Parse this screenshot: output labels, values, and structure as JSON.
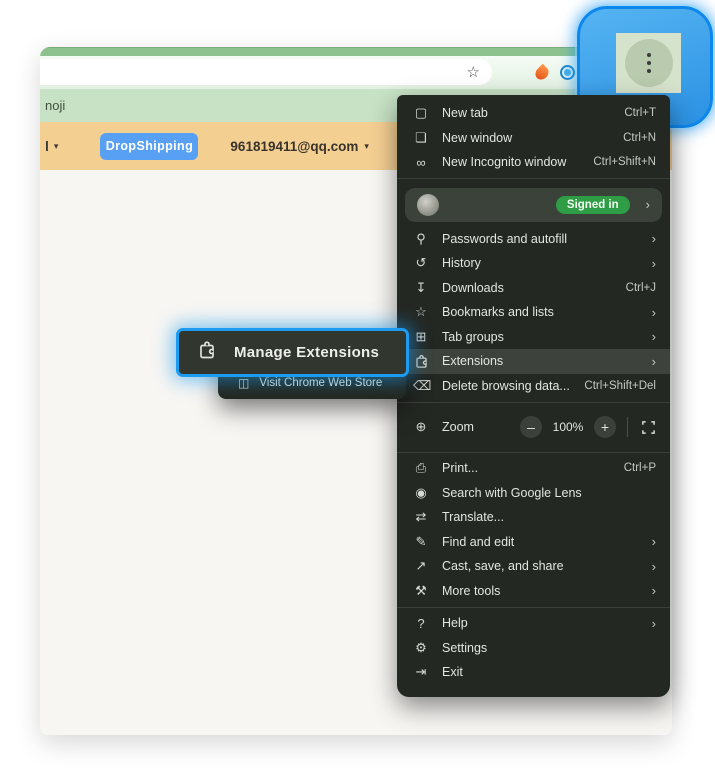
{
  "toolbar": {
    "bookmark_bar_text": "noji",
    "stub_text": "l",
    "caret": "▾",
    "dropshipping_label": "DropShipping",
    "email": "961819411@qq.com"
  },
  "menu": {
    "blocks": [
      {
        "type": "items",
        "items": [
          {
            "icon": "new-tab-icon",
            "glyph": "▢",
            "label": "New tab",
            "shortcut": "Ctrl+T"
          },
          {
            "icon": "new-window-icon",
            "glyph": "❏",
            "label": "New window",
            "shortcut": "Ctrl+N"
          },
          {
            "icon": "incognito-icon",
            "glyph": "∞",
            "label": "New Incognito window",
            "shortcut": "Ctrl+Shift+N"
          }
        ]
      },
      {
        "type": "divider"
      },
      {
        "type": "account",
        "badge": "Signed in",
        "chevron": "›"
      },
      {
        "type": "items",
        "items": [
          {
            "icon": "key-icon",
            "glyph": "⚲",
            "label": "Passwords and autofill",
            "chevron": "›"
          },
          {
            "icon": "history-icon",
            "glyph": "↺",
            "label": "History",
            "chevron": "›"
          },
          {
            "icon": "download-icon",
            "glyph": "↧",
            "label": "Downloads",
            "shortcut": "Ctrl+J"
          },
          {
            "icon": "star-icon",
            "glyph": "☆",
            "label": "Bookmarks and lists",
            "chevron": "›"
          },
          {
            "icon": "tab-groups-icon",
            "glyph": "⊞",
            "label": "Tab groups",
            "chevron": "›"
          },
          {
            "icon": "extensions-icon",
            "puzzle": true,
            "label": "Extensions",
            "chevron": "›",
            "selected": true
          },
          {
            "icon": "trash-icon",
            "glyph": "⌫",
            "label": "Delete browsing data...",
            "shortcut": "Ctrl+Shift+Del"
          }
        ]
      },
      {
        "type": "divider"
      },
      {
        "type": "zoom",
        "icon": "zoom-icon",
        "glyph": "⊕",
        "label": "Zoom",
        "minus": "–",
        "value": "100%",
        "plus": "+"
      },
      {
        "type": "divider"
      },
      {
        "type": "items",
        "items": [
          {
            "icon": "print-icon",
            "glyph": "⎙",
            "label": "Print...",
            "shortcut": "Ctrl+P"
          },
          {
            "icon": "lens-icon",
            "glyph": "◉",
            "label": "Search with Google Lens"
          },
          {
            "icon": "translate-icon",
            "glyph": "⇄",
            "label": "Translate..."
          },
          {
            "icon": "find-icon",
            "glyph": "✎",
            "label": "Find and edit",
            "chevron": "›"
          },
          {
            "icon": "cast-icon",
            "glyph": "↗",
            "label": "Cast, save, and share",
            "chevron": "›"
          },
          {
            "icon": "tools-icon",
            "glyph": "⚒",
            "label": "More tools",
            "chevron": "›"
          }
        ]
      },
      {
        "type": "divider"
      },
      {
        "type": "items",
        "items": [
          {
            "icon": "help-icon",
            "glyph": "?",
            "label": "Help",
            "chevron": "›"
          },
          {
            "icon": "gear-icon",
            "glyph": "⚙",
            "label": "Settings"
          },
          {
            "icon": "exit-icon",
            "glyph": "⇥",
            "label": "Exit"
          }
        ]
      }
    ]
  },
  "submenu": {
    "manage_label": "Manage Extensions",
    "visit_label": "Visit Chrome Web Store"
  },
  "colors": {
    "annotation_blue": "#1d9bf0",
    "signed_in_green": "#2f9d45",
    "dropshipping_blue": "#57a0f3",
    "menu_bg": "#242823"
  }
}
